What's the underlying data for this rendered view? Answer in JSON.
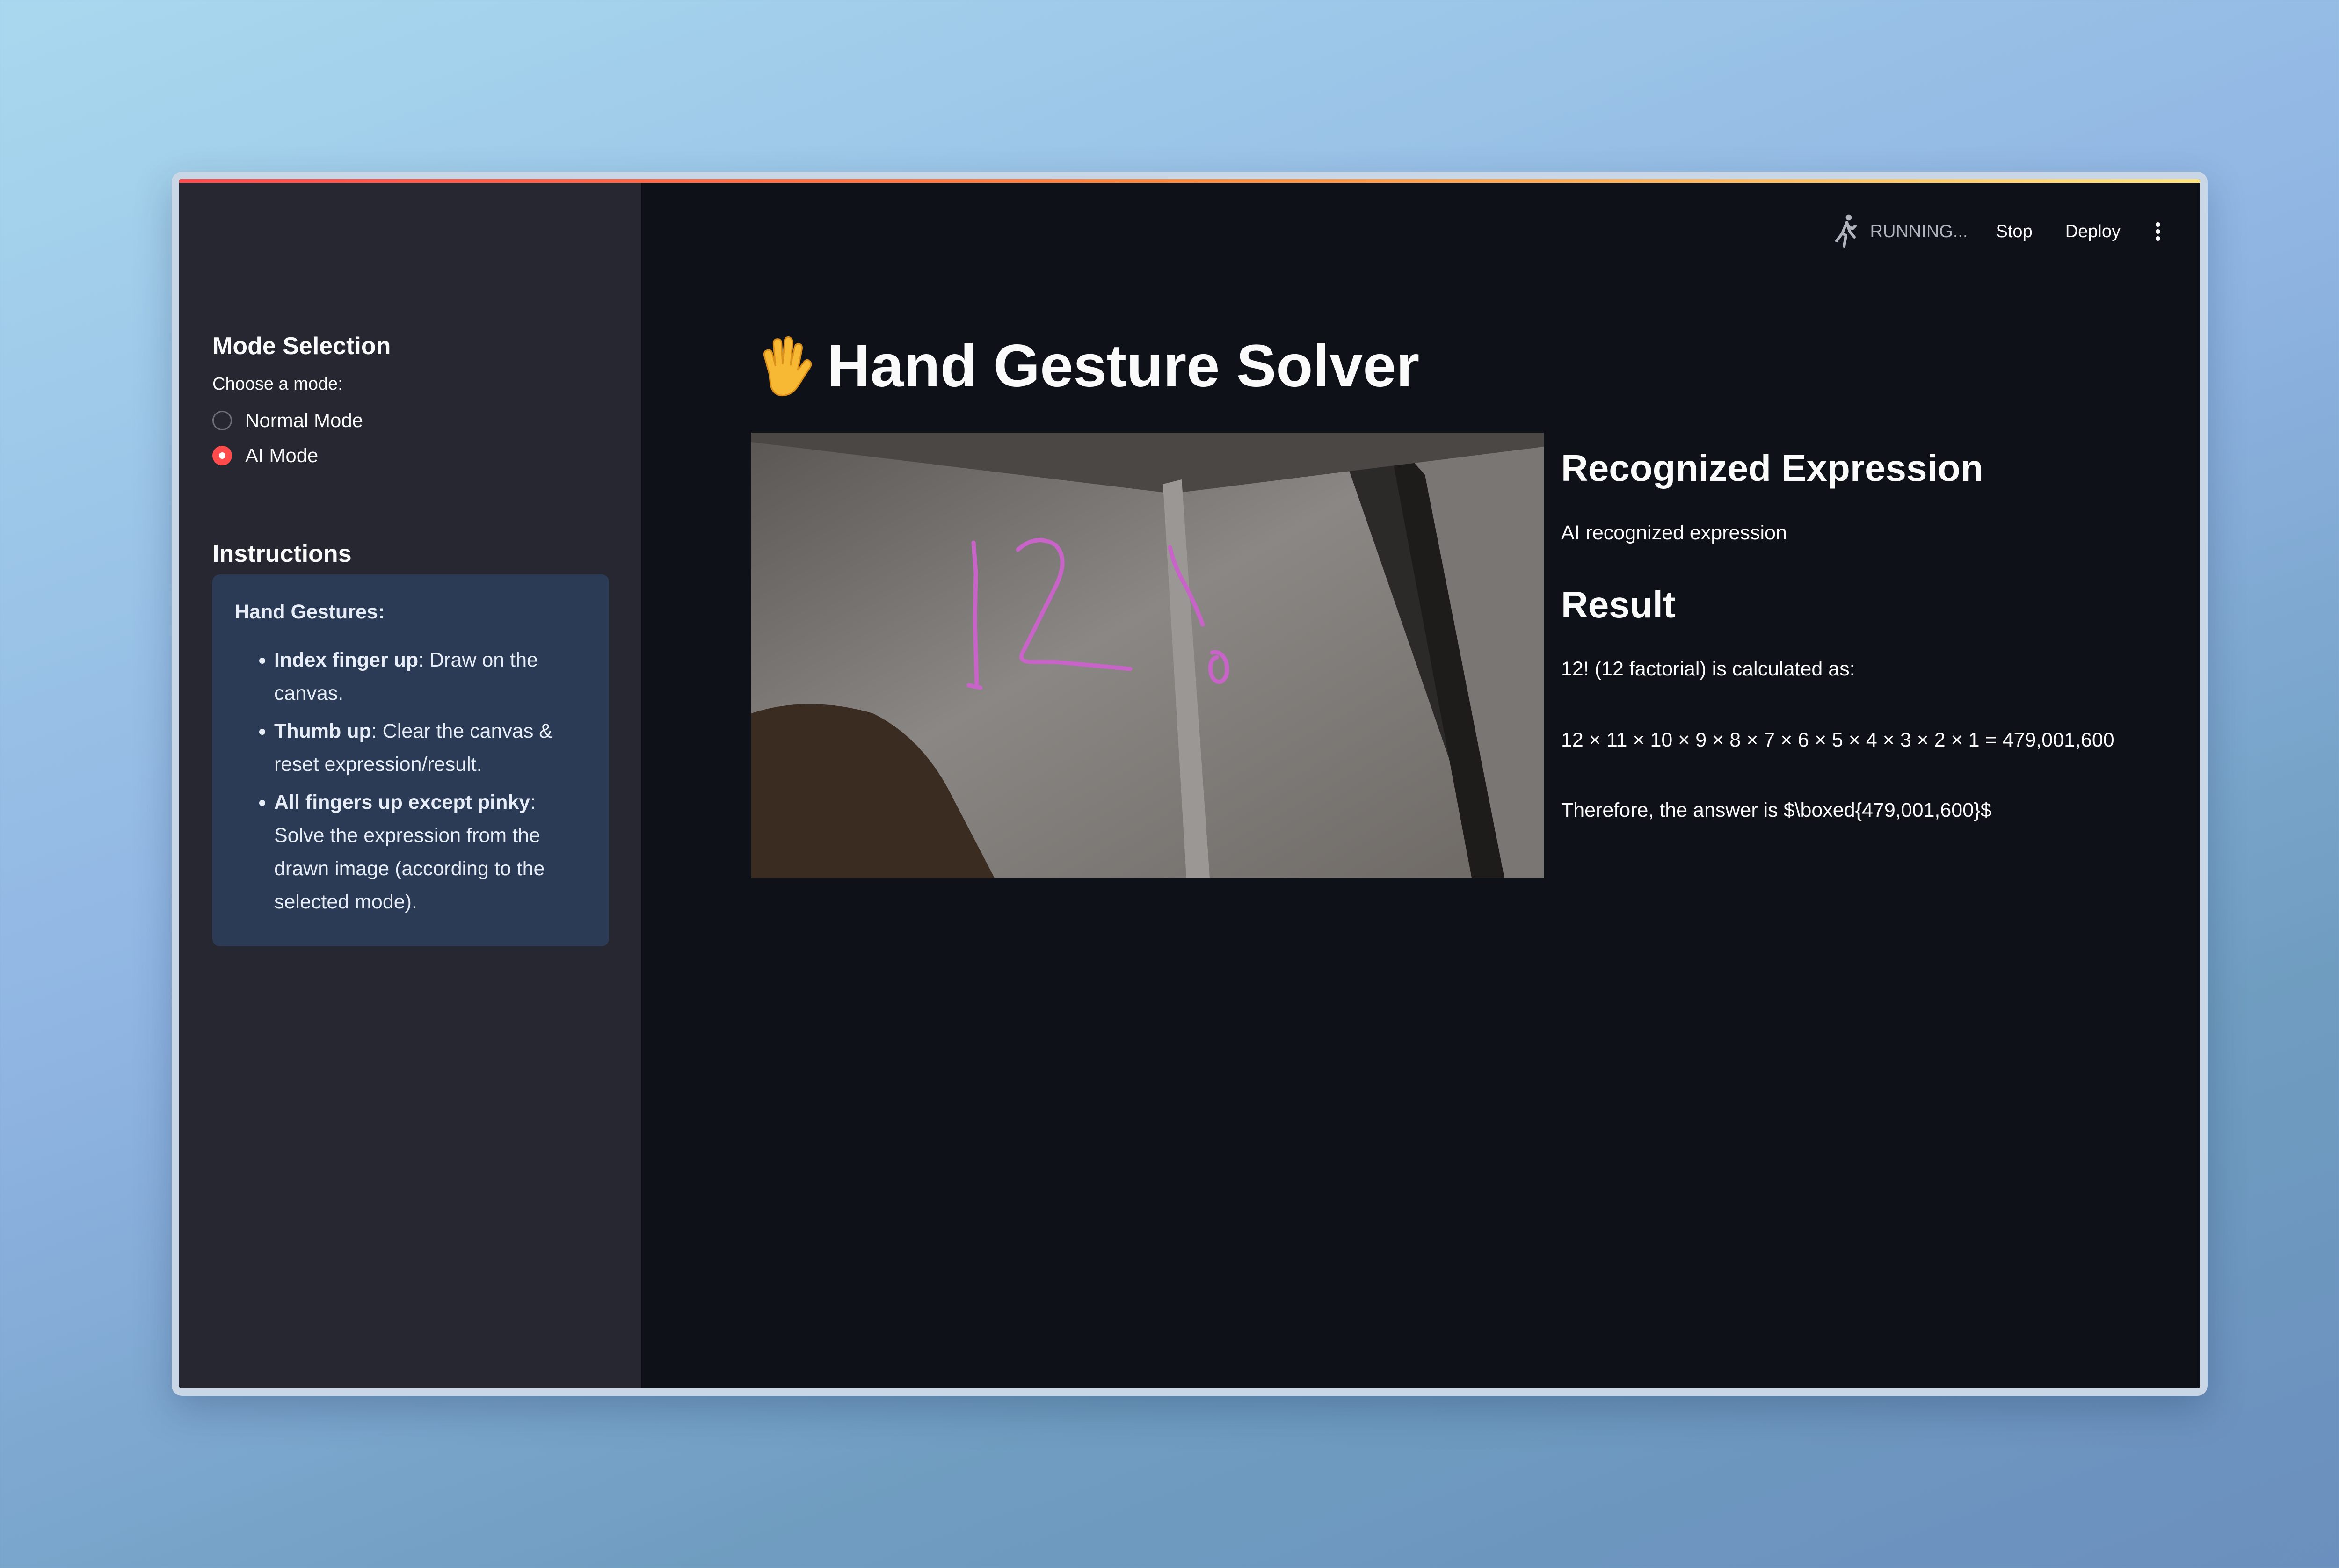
{
  "sidebar": {
    "mode_heading": "Mode Selection",
    "mode_label": "Choose a mode:",
    "modes": [
      {
        "label": "Normal Mode",
        "selected": false
      },
      {
        "label": "AI Mode",
        "selected": true
      }
    ],
    "instructions_heading": "Instructions",
    "info": {
      "header": "Hand Gestures:",
      "items": [
        {
          "bold": "Index finger up",
          "text": ": Draw on the canvas."
        },
        {
          "bold": "Thumb up",
          "text": ": Clear the canvas & reset expression/result."
        },
        {
          "bold": "All fingers up except pinky",
          "text": ": Solve the expression from the drawn image (according to the selected mode)."
        }
      ]
    }
  },
  "toolbar": {
    "status": "RUNNING...",
    "stop": "Stop",
    "deploy": "Deploy",
    "menu_icon": "kebab-menu-icon"
  },
  "main": {
    "title": "Hand Gesture Solver",
    "title_icon": "raised-hand-icon",
    "recognized_heading": "Recognized Expression",
    "recognized_text": "AI recognized expression",
    "result_heading": "Result",
    "result_lines": [
      "12! (12 factorial) is calculated as:",
      "12 × 11 × 10 × 9 × 8 × 7 × 6 × 5 × 4 × 3 × 2 × 1 = 479,001,600",
      "Therefore, the answer is $\\boxed{479,001,600}$"
    ]
  },
  "colors": {
    "accent": "#ff4b4b",
    "sidebar_bg": "#262730",
    "main_bg": "#0e1117",
    "info_bg": "#2b3a55",
    "drawing_stroke": "#c864c8"
  }
}
